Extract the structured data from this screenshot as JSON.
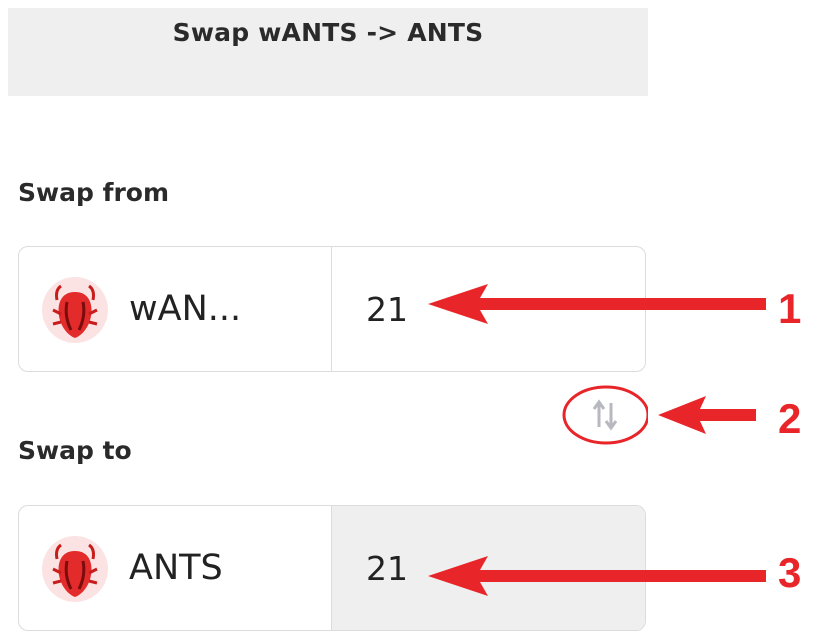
{
  "header": {
    "title": "Swap wANTS -> ANTS"
  },
  "swap_from": {
    "label": "Swap from",
    "token": {
      "name": "wAN...",
      "icon": "ant-token-icon"
    },
    "amount": "21"
  },
  "swap_to": {
    "label": "Swap to",
    "token": {
      "name": "ANTS",
      "icon": "ant-token-icon"
    },
    "amount": "21"
  },
  "swap_toggle": {
    "icon": "swap-direction-icon"
  },
  "annotations": [
    {
      "number": "1"
    },
    {
      "number": "2"
    },
    {
      "number": "3"
    }
  ],
  "colors": {
    "annotation": "#e8262a",
    "header_bg": "#efefef",
    "border": "#dcdcdc",
    "readonly_bg": "#efefef"
  }
}
